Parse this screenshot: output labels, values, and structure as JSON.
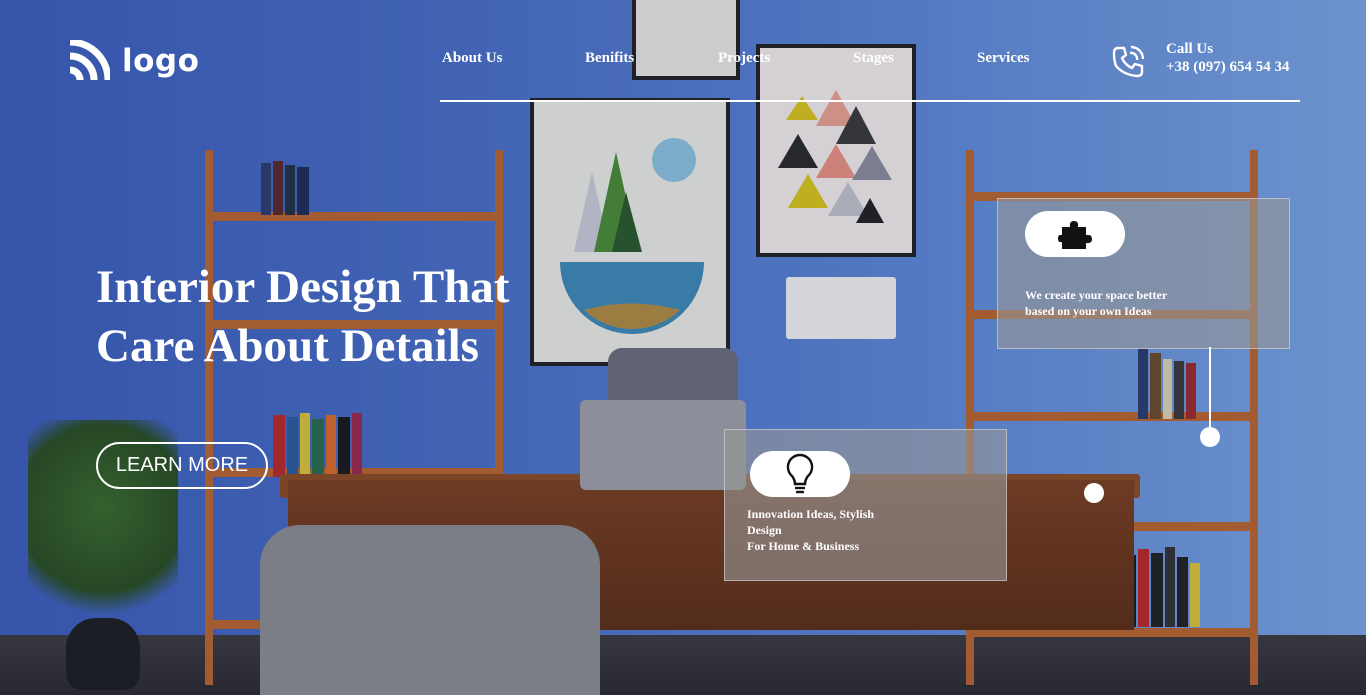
{
  "logo": {
    "text": "logo",
    "icon": "signal-waves-icon"
  },
  "nav": {
    "items": [
      {
        "label": "About Us"
      },
      {
        "label": "Benifits"
      },
      {
        "label": "Projects"
      },
      {
        "label": "Stages"
      },
      {
        "label": "Services"
      }
    ]
  },
  "contact": {
    "label": "Call Us",
    "phone": "+38 (097) 654 54 34",
    "icon": "phone-call-icon"
  },
  "hero": {
    "title_line1": "Interior Design That",
    "title_line2": "Care About Details",
    "button_label": "LEARN MORE"
  },
  "features": [
    {
      "icon": "puzzle-icon",
      "line1": "We create your space better",
      "line2": "based on your own Ideas"
    },
    {
      "icon": "lightbulb-icon",
      "line1": "Innovation Ideas, Stylish",
      "line2": "Design",
      "line3": "For Home & Business"
    }
  ],
  "colors": {
    "background": "#4b6fc2",
    "text": "#ffffff",
    "wood": "#b8642e"
  }
}
